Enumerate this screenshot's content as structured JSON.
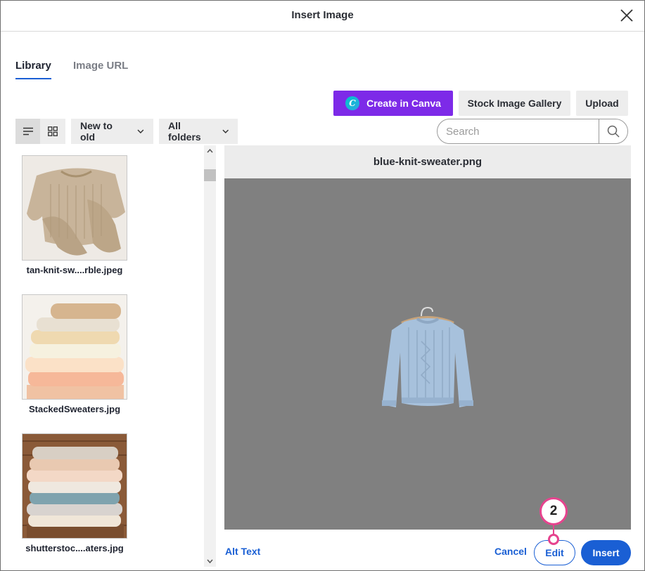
{
  "dialog": {
    "title": "Insert Image"
  },
  "tabs": [
    {
      "label": "Library",
      "active": true
    },
    {
      "label": "Image URL",
      "active": false
    }
  ],
  "toolbar": {
    "canva_label": "Create in Canva",
    "canva_logo_letter": "C",
    "stock_label": "Stock Image Gallery",
    "upload_label": "Upload",
    "sort_selected": "New to old",
    "folder_selected": "All folders",
    "view_mode": "list",
    "search_placeholder": "Search"
  },
  "library": {
    "items": [
      {
        "name": "tan-knit-sw....rble.jpeg"
      },
      {
        "name": "StackedSweaters.jpg"
      },
      {
        "name": "shutterstoc....aters.jpg"
      }
    ]
  },
  "preview": {
    "filename": "blue-knit-sweater.png"
  },
  "footer": {
    "alt_text_label": "Alt Text",
    "cancel_label": "Cancel",
    "edit_label": "Edit",
    "insert_label": "Insert"
  },
  "callout": {
    "number": "2"
  },
  "colors": {
    "canva_purple": "#7d2ae8",
    "primary_blue": "#1a5fd4",
    "callout_pink": "#e6438e",
    "preview_bg": "#808080"
  }
}
